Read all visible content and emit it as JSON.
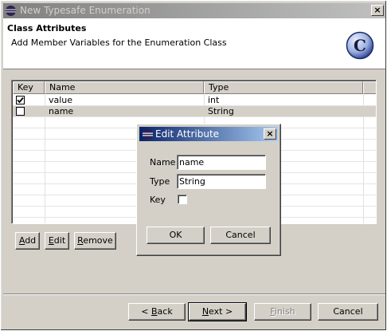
{
  "window": {
    "title": "New Typesafe Enumeration",
    "close_label": "×"
  },
  "header": {
    "title": "Class Attributes",
    "subtitle": "Add Member Variables for the Enumeration Class",
    "logo_letter": "C"
  },
  "table": {
    "columns": [
      "Key",
      "Name",
      "Type"
    ],
    "rows": [
      {
        "key": true,
        "name": "value",
        "type": "int"
      },
      {
        "key": false,
        "name": "name",
        "type": "String"
      }
    ]
  },
  "table_buttons": {
    "add": {
      "mnemonic": "A",
      "rest": "dd"
    },
    "edit": {
      "mnemonic": "E",
      "rest": "dit"
    },
    "remove": {
      "mnemonic": "R",
      "rest": "emove"
    }
  },
  "wizard_buttons": {
    "back": {
      "prefix": "< ",
      "mnemonic": "B",
      "rest": "ack"
    },
    "next": {
      "mnemonic": "N",
      "rest": "ext >"
    },
    "finish": {
      "mnemonic": "F",
      "rest": "inish"
    },
    "cancel": "Cancel"
  },
  "dialog": {
    "title": "Edit Attribute",
    "close_label": "×",
    "name_label": "Name",
    "name_value": "name",
    "type_label": "Type",
    "type_value": "String",
    "key_label": "Key",
    "key_checked": false,
    "ok_label": "OK",
    "cancel_label": "Cancel"
  },
  "colors": {
    "window_bg": "#d4d0c8",
    "active_title": "#0a246a",
    "inactive_title": "#808080"
  }
}
